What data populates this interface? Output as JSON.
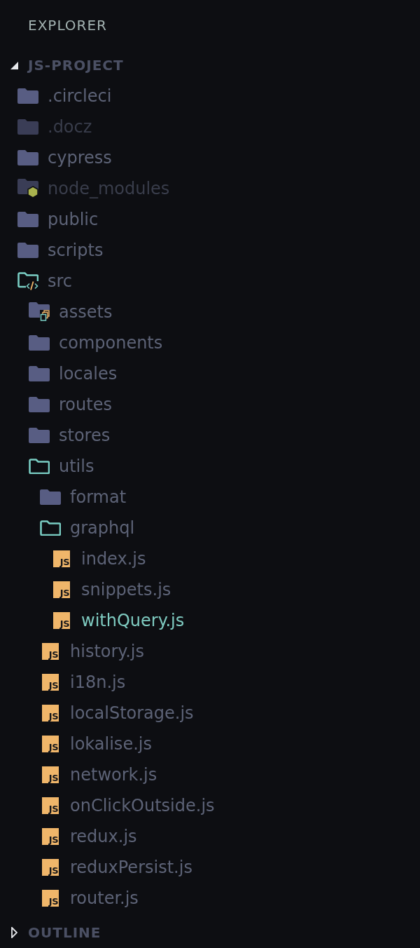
{
  "sidebar": {
    "title": "EXPLORER",
    "sections": [
      {
        "title": "JS-PROJECT",
        "expanded": true,
        "tree": [
          {
            "name": ".circleci",
            "kind": "folder",
            "expanded": false,
            "dimmed": false,
            "selected": false
          },
          {
            "name": ".docz",
            "kind": "folder",
            "expanded": false,
            "dimmed": true,
            "selected": false
          },
          {
            "name": "cypress",
            "kind": "folder",
            "expanded": false,
            "dimmed": false,
            "selected": false
          },
          {
            "name": "node_modules",
            "kind": "packages",
            "expanded": false,
            "dimmed": true,
            "selected": false
          },
          {
            "name": "public",
            "kind": "folder",
            "expanded": false,
            "dimmed": false,
            "selected": false
          },
          {
            "name": "scripts",
            "kind": "folder",
            "expanded": false,
            "dimmed": false,
            "selected": false
          },
          {
            "name": "src",
            "kind": "source",
            "expanded": true,
            "dimmed": false,
            "selected": false,
            "children": [
              {
                "name": "assets",
                "kind": "assets",
                "expanded": false,
                "dimmed": false,
                "selected": false
              },
              {
                "name": "components",
                "kind": "folder",
                "expanded": false,
                "dimmed": false,
                "selected": false
              },
              {
                "name": "locales",
                "kind": "folder",
                "expanded": false,
                "dimmed": false,
                "selected": false
              },
              {
                "name": "routes",
                "kind": "folder",
                "expanded": false,
                "dimmed": false,
                "selected": false
              },
              {
                "name": "stores",
                "kind": "folder",
                "expanded": false,
                "dimmed": false,
                "selected": false
              },
              {
                "name": "utils",
                "kind": "folder",
                "expanded": true,
                "dimmed": false,
                "selected": false,
                "children": [
                  {
                    "name": "format",
                    "kind": "folder",
                    "expanded": false,
                    "dimmed": false,
                    "selected": false
                  },
                  {
                    "name": "graphql",
                    "kind": "folder",
                    "expanded": true,
                    "dimmed": false,
                    "selected": false,
                    "children": [
                      {
                        "name": "index.js",
                        "kind": "script",
                        "badge": "JS",
                        "dimmed": false,
                        "selected": false
                      },
                      {
                        "name": "snippets.js",
                        "kind": "script",
                        "badge": "JS",
                        "dimmed": false,
                        "selected": false
                      },
                      {
                        "name": "withQuery.js",
                        "kind": "script",
                        "badge": "JS",
                        "dimmed": false,
                        "selected": true
                      }
                    ]
                  },
                  {
                    "name": "history.js",
                    "kind": "script",
                    "badge": "JS",
                    "dimmed": false,
                    "selected": false
                  },
                  {
                    "name": "i18n.js",
                    "kind": "script",
                    "badge": "JS",
                    "dimmed": false,
                    "selected": false
                  },
                  {
                    "name": "localStorage.js",
                    "kind": "script",
                    "badge": "JS",
                    "dimmed": false,
                    "selected": false
                  },
                  {
                    "name": "lokalise.js",
                    "kind": "script",
                    "badge": "JS",
                    "dimmed": false,
                    "selected": false
                  },
                  {
                    "name": "network.js",
                    "kind": "script",
                    "badge": "JS",
                    "dimmed": false,
                    "selected": false
                  },
                  {
                    "name": "onClickOutside.js",
                    "kind": "script",
                    "badge": "JS",
                    "dimmed": false,
                    "selected": false
                  },
                  {
                    "name": "redux.js",
                    "kind": "script",
                    "badge": "JS",
                    "dimmed": false,
                    "selected": false
                  },
                  {
                    "name": "reduxPersist.js",
                    "kind": "script",
                    "badge": "JS",
                    "dimmed": false,
                    "selected": false
                  },
                  {
                    "name": "router.js",
                    "kind": "script",
                    "badge": "JS",
                    "dimmed": false,
                    "selected": false
                  }
                ]
              }
            ]
          }
        ]
      },
      {
        "title": "OUTLINE",
        "expanded": false
      }
    ]
  }
}
